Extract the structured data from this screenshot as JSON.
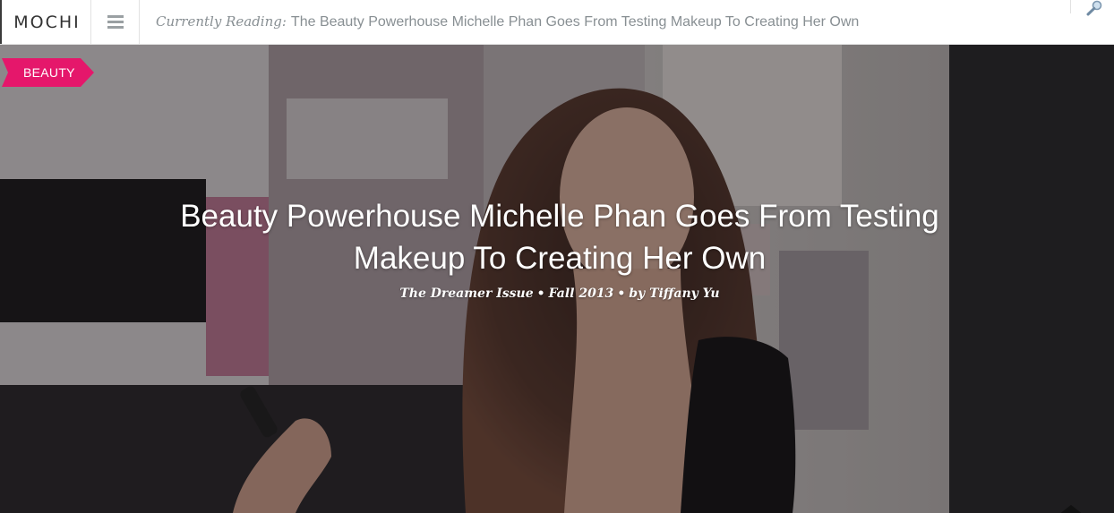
{
  "header": {
    "brand": "MOCHI",
    "menu_icon": "hamburger-menu-icon",
    "reading_prefix": "Currently Reading:",
    "reading_title": "The Beauty Powerhouse Michelle Phan Goes From Testing Makeup To Creating Her Own",
    "search_icon": "magnifier-icon"
  },
  "hero": {
    "category": "BEAUTY",
    "headline": "Beauty Powerhouse Michelle Phan Goes From Testing Makeup To Creating Her Own",
    "byline": {
      "issue": "The Dreamer Issue",
      "season": "Fall 2013",
      "author": "by Tiffany Yu",
      "separator": "•"
    },
    "scroll_icon": "up-arrow-icon"
  },
  "colors": {
    "category_tag": "#e5176b",
    "nav_text": "#888f93",
    "brand_text": "#333333"
  }
}
